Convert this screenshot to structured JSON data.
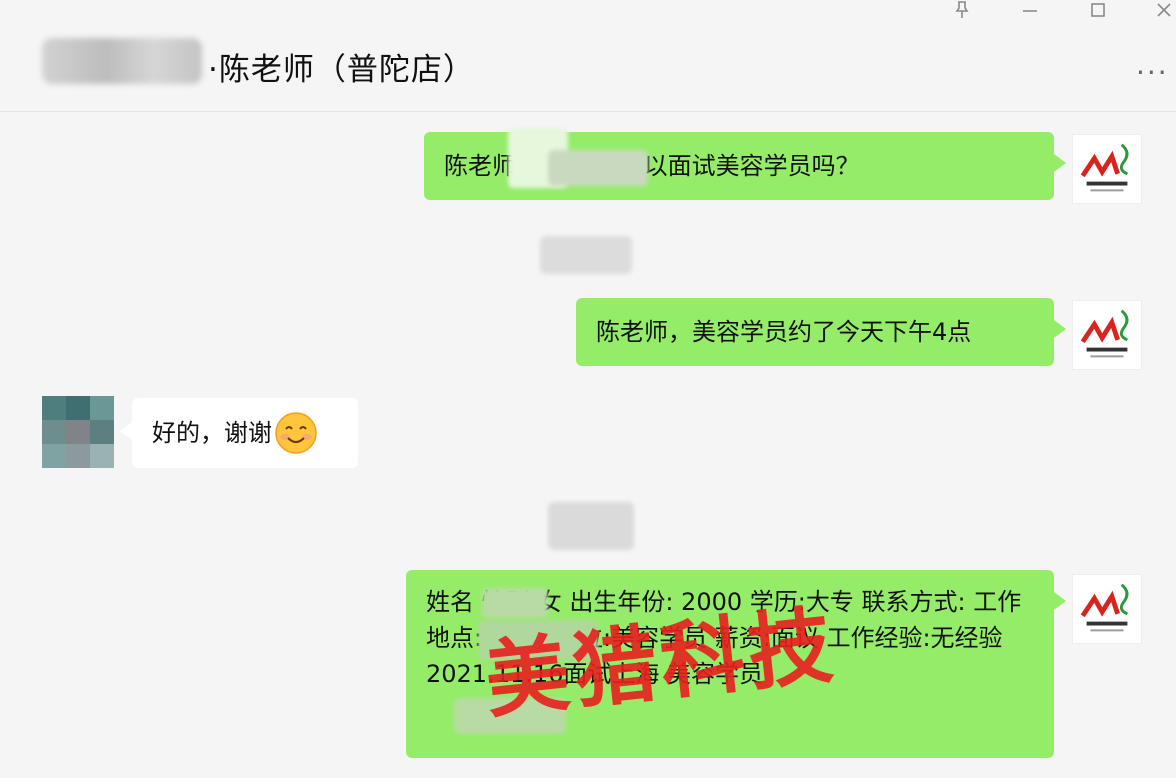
{
  "window": {
    "chat_title": "·陈老师（普陀店）",
    "pin_icon": "pin-icon",
    "minimize_icon": "minimize-icon",
    "maximize_icon": "maximize-icon",
    "close_icon": "close-icon",
    "more_label": "···"
  },
  "messages": [
    {
      "sender": "me",
      "text": "陈老师 午十一点可以面试美容学员吗？"
    },
    {
      "sender": "me",
      "text": "陈老师，美容学员约了今天下午4点"
    },
    {
      "sender": "other",
      "text": "好的，谢谢",
      "emoji": "smile-emoji"
    },
    {
      "sender": "me",
      "text": "姓名 性别:女 出生年份: 2000 学历:大专 联系方式: 工作地点:上海-- 岗位:美容学员 薪资:面议 工作经验:无经验 2021.11.16面试上海 美容学员"
    }
  ],
  "watermark": "美猎科技",
  "colors": {
    "mine_bubble": "#95ec69",
    "other_bubble": "#ffffff",
    "watermark": "#e8201e",
    "background": "#f5f5f5"
  }
}
